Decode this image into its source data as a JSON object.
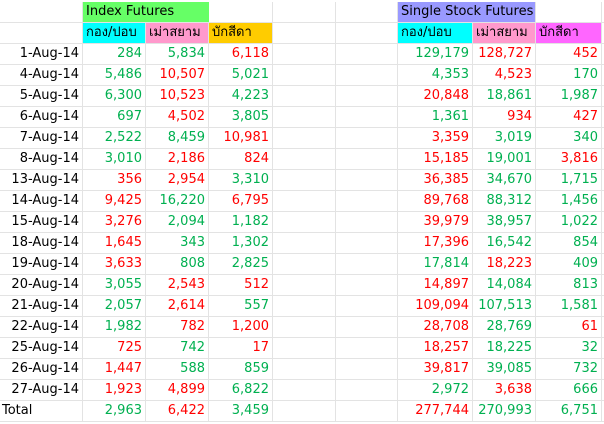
{
  "index_futures": {
    "title": "Index Futures",
    "headers": [
      "กอง/ปอบ",
      "เม่าสยาม",
      "บักสีดา"
    ]
  },
  "single_stock_futures": {
    "title": "Single Stock Futures",
    "headers": [
      "กอง/ปอบ",
      "เม่าสยาม",
      "บักสีดา"
    ]
  },
  "colors": {
    "positive": "#00b050",
    "negative": "#ff0000",
    "index_title_bg": "#66ff66",
    "single_title_bg": "#9999ff",
    "col1_bg": "#00ffff",
    "col2_bg": "#ff99cc",
    "col3_index_bg": "#ffcc00",
    "col3_single_bg": "#ff66ff"
  },
  "rows": [
    {
      "date": "1-Aug-14",
      "idx": [
        "284",
        "5,834",
        "6,118"
      ],
      "idx_sign": [
        "pos",
        "pos",
        "neg"
      ],
      "ssf": [
        "129,179",
        "128,727",
        "452"
      ],
      "ssf_sign": [
        "pos",
        "neg",
        "neg"
      ]
    },
    {
      "date": "4-Aug-14",
      "idx": [
        "5,486",
        "10,507",
        "5,021"
      ],
      "idx_sign": [
        "pos",
        "neg",
        "pos"
      ],
      "ssf": [
        "4,353",
        "4,523",
        "170"
      ],
      "ssf_sign": [
        "pos",
        "neg",
        "pos"
      ]
    },
    {
      "date": "5-Aug-14",
      "idx": [
        "6,300",
        "10,523",
        "4,223"
      ],
      "idx_sign": [
        "pos",
        "neg",
        "pos"
      ],
      "ssf": [
        "20,848",
        "18,861",
        "1,987"
      ],
      "ssf_sign": [
        "neg",
        "pos",
        "pos"
      ]
    },
    {
      "date": "6-Aug-14",
      "idx": [
        "697",
        "4,502",
        "3,805"
      ],
      "idx_sign": [
        "pos",
        "neg",
        "pos"
      ],
      "ssf": [
        "1,361",
        "934",
        "427"
      ],
      "ssf_sign": [
        "pos",
        "neg",
        "neg"
      ]
    },
    {
      "date": "7-Aug-14",
      "idx": [
        "2,522",
        "8,459",
        "10,981"
      ],
      "idx_sign": [
        "pos",
        "pos",
        "neg"
      ],
      "ssf": [
        "3,359",
        "3,019",
        "340"
      ],
      "ssf_sign": [
        "neg",
        "pos",
        "pos"
      ]
    },
    {
      "date": "8-Aug-14",
      "idx": [
        "3,010",
        "2,186",
        "824"
      ],
      "idx_sign": [
        "pos",
        "neg",
        "neg"
      ],
      "ssf": [
        "15,185",
        "19,001",
        "3,816"
      ],
      "ssf_sign": [
        "neg",
        "pos",
        "neg"
      ]
    },
    {
      "date": "13-Aug-14",
      "idx": [
        "356",
        "2,954",
        "3,310"
      ],
      "idx_sign": [
        "neg",
        "neg",
        "pos"
      ],
      "ssf": [
        "36,385",
        "34,670",
        "1,715"
      ],
      "ssf_sign": [
        "neg",
        "pos",
        "pos"
      ]
    },
    {
      "date": "14-Aug-14",
      "idx": [
        "9,425",
        "16,220",
        "6,795"
      ],
      "idx_sign": [
        "neg",
        "pos",
        "neg"
      ],
      "ssf": [
        "89,768",
        "88,312",
        "1,456"
      ],
      "ssf_sign": [
        "neg",
        "pos",
        "pos"
      ]
    },
    {
      "date": "15-Aug-14",
      "idx": [
        "3,276",
        "2,094",
        "1,182"
      ],
      "idx_sign": [
        "neg",
        "pos",
        "pos"
      ],
      "ssf": [
        "39,979",
        "38,957",
        "1,022"
      ],
      "ssf_sign": [
        "neg",
        "pos",
        "pos"
      ]
    },
    {
      "date": "18-Aug-14",
      "idx": [
        "1,645",
        "343",
        "1,302"
      ],
      "idx_sign": [
        "neg",
        "pos",
        "pos"
      ],
      "ssf": [
        "17,396",
        "16,542",
        "854"
      ],
      "ssf_sign": [
        "neg",
        "pos",
        "pos"
      ]
    },
    {
      "date": "19-Aug-14",
      "idx": [
        "3,633",
        "808",
        "2,825"
      ],
      "idx_sign": [
        "neg",
        "pos",
        "pos"
      ],
      "ssf": [
        "17,814",
        "18,223",
        "409"
      ],
      "ssf_sign": [
        "pos",
        "neg",
        "pos"
      ]
    },
    {
      "date": "20-Aug-14",
      "idx": [
        "3,055",
        "2,543",
        "512"
      ],
      "idx_sign": [
        "pos",
        "neg",
        "neg"
      ],
      "ssf": [
        "14,897",
        "14,084",
        "813"
      ],
      "ssf_sign": [
        "neg",
        "pos",
        "pos"
      ]
    },
    {
      "date": "21-Aug-14",
      "idx": [
        "2,057",
        "2,614",
        "557"
      ],
      "idx_sign": [
        "pos",
        "neg",
        "pos"
      ],
      "ssf": [
        "109,094",
        "107,513",
        "1,581"
      ],
      "ssf_sign": [
        "neg",
        "pos",
        "pos"
      ]
    },
    {
      "date": "22-Aug-14",
      "idx": [
        "1,982",
        "782",
        "1,200"
      ],
      "idx_sign": [
        "pos",
        "neg",
        "neg"
      ],
      "ssf": [
        "28,708",
        "28,769",
        "61"
      ],
      "ssf_sign": [
        "neg",
        "pos",
        "neg"
      ]
    },
    {
      "date": "25-Aug-14",
      "idx": [
        "725",
        "742",
        "17"
      ],
      "idx_sign": [
        "neg",
        "pos",
        "neg"
      ],
      "ssf": [
        "18,257",
        "18,225",
        "32"
      ],
      "ssf_sign": [
        "neg",
        "pos",
        "pos"
      ]
    },
    {
      "date": "26-Aug-14",
      "idx": [
        "1,447",
        "588",
        "859"
      ],
      "idx_sign": [
        "neg",
        "pos",
        "pos"
      ],
      "ssf": [
        "39,817",
        "39,085",
        "732"
      ],
      "ssf_sign": [
        "neg",
        "pos",
        "pos"
      ]
    },
    {
      "date": "27-Aug-14",
      "idx": [
        "1,923",
        "4,899",
        "6,822"
      ],
      "idx_sign": [
        "neg",
        "neg",
        "pos"
      ],
      "ssf": [
        "2,972",
        "3,638",
        "666"
      ],
      "ssf_sign": [
        "pos",
        "neg",
        "pos"
      ]
    }
  ],
  "total": {
    "label": "Total",
    "idx": [
      "2,963",
      "6,422",
      "3,459"
    ],
    "idx_sign": [
      "pos",
      "neg",
      "pos"
    ],
    "ssf": [
      "277,744",
      "270,993",
      "6,751"
    ],
    "ssf_sign": [
      "neg",
      "pos",
      "pos"
    ]
  }
}
